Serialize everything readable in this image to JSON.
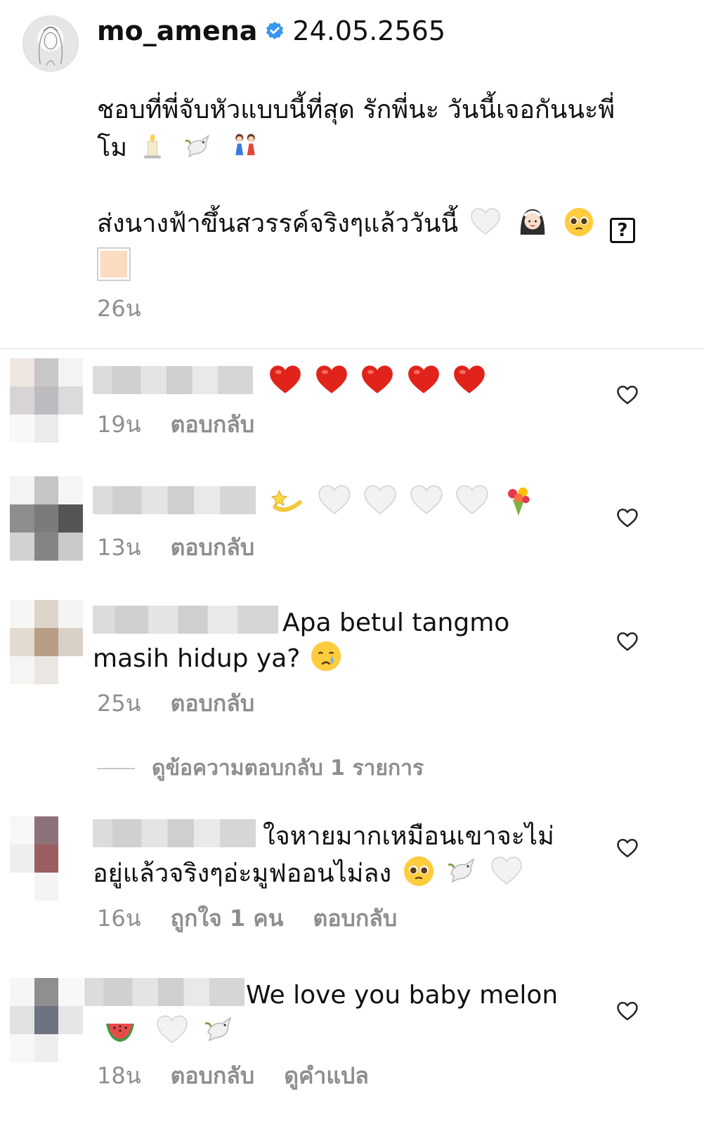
{
  "caption": {
    "username": "mo_amena",
    "verified_icon": "verified-badge-icon",
    "date": "24.05.2565",
    "line1": "ชอบที่พี่จับหัวแบบนี้ที่สุด รักพี่นะ วันนี้เจอกันนะพี่",
    "line2": "โม",
    "line2_emojis": [
      "candle-icon",
      "dove-icon",
      "two-girls-icon"
    ],
    "line3": "ส่งนางฟ้าขึ้นสวรรค์จริงๆแล้ววันนี้",
    "line3_emojis": [
      "white-heart-icon",
      "bride-icon",
      "pleading-face-icon"
    ],
    "unknown_glyph": "?",
    "time": "26น"
  },
  "comments": [
    {
      "text": "",
      "emojis": [
        "red-heart-icon",
        "red-heart-icon",
        "red-heart-icon",
        "red-heart-icon",
        "red-heart-icon"
      ],
      "time": "19น",
      "reply": "ตอบกลับ"
    },
    {
      "text": "",
      "emojis": [
        "shooting-star-icon",
        "white-heart-icon",
        "white-heart-icon",
        "white-heart-icon",
        "white-heart-icon",
        "bouquet-icon"
      ],
      "time": "13น",
      "reply": "ตอบกลับ"
    },
    {
      "text_line1": "Apa betul tangmo",
      "text_line2": "masih hidup ya?",
      "emojis": [
        "crying-face-icon"
      ],
      "time": "25น",
      "reply": "ตอบกลับ"
    },
    {
      "text_line1": "ใจหายมากเหมือนเขาจะไม่",
      "text_line2": "อยู่แล้วจริงๆอ่ะมูฟออนไม่ลง",
      "emojis": [
        "pleading-face-icon",
        "dove-icon",
        "white-heart-icon"
      ],
      "time": "16น",
      "likes": "ถูกใจ 1 คน",
      "reply": "ตอบกลับ"
    },
    {
      "text_line1": "We love you baby melon",
      "emojis": [
        "watermelon-icon",
        "white-heart-icon",
        "dove-icon"
      ],
      "time": "18น",
      "reply": "ตอบกลับ",
      "translate": "ดูคำแปล"
    }
  ],
  "view_replies": "ดูข้อความตอบกลับ 1 รายการ",
  "like_icon": "heart-outline-icon",
  "colors": {
    "secondary_text": "#8e8e8e",
    "verified_blue": "#3897f0",
    "red_heart": "#e0241b"
  }
}
